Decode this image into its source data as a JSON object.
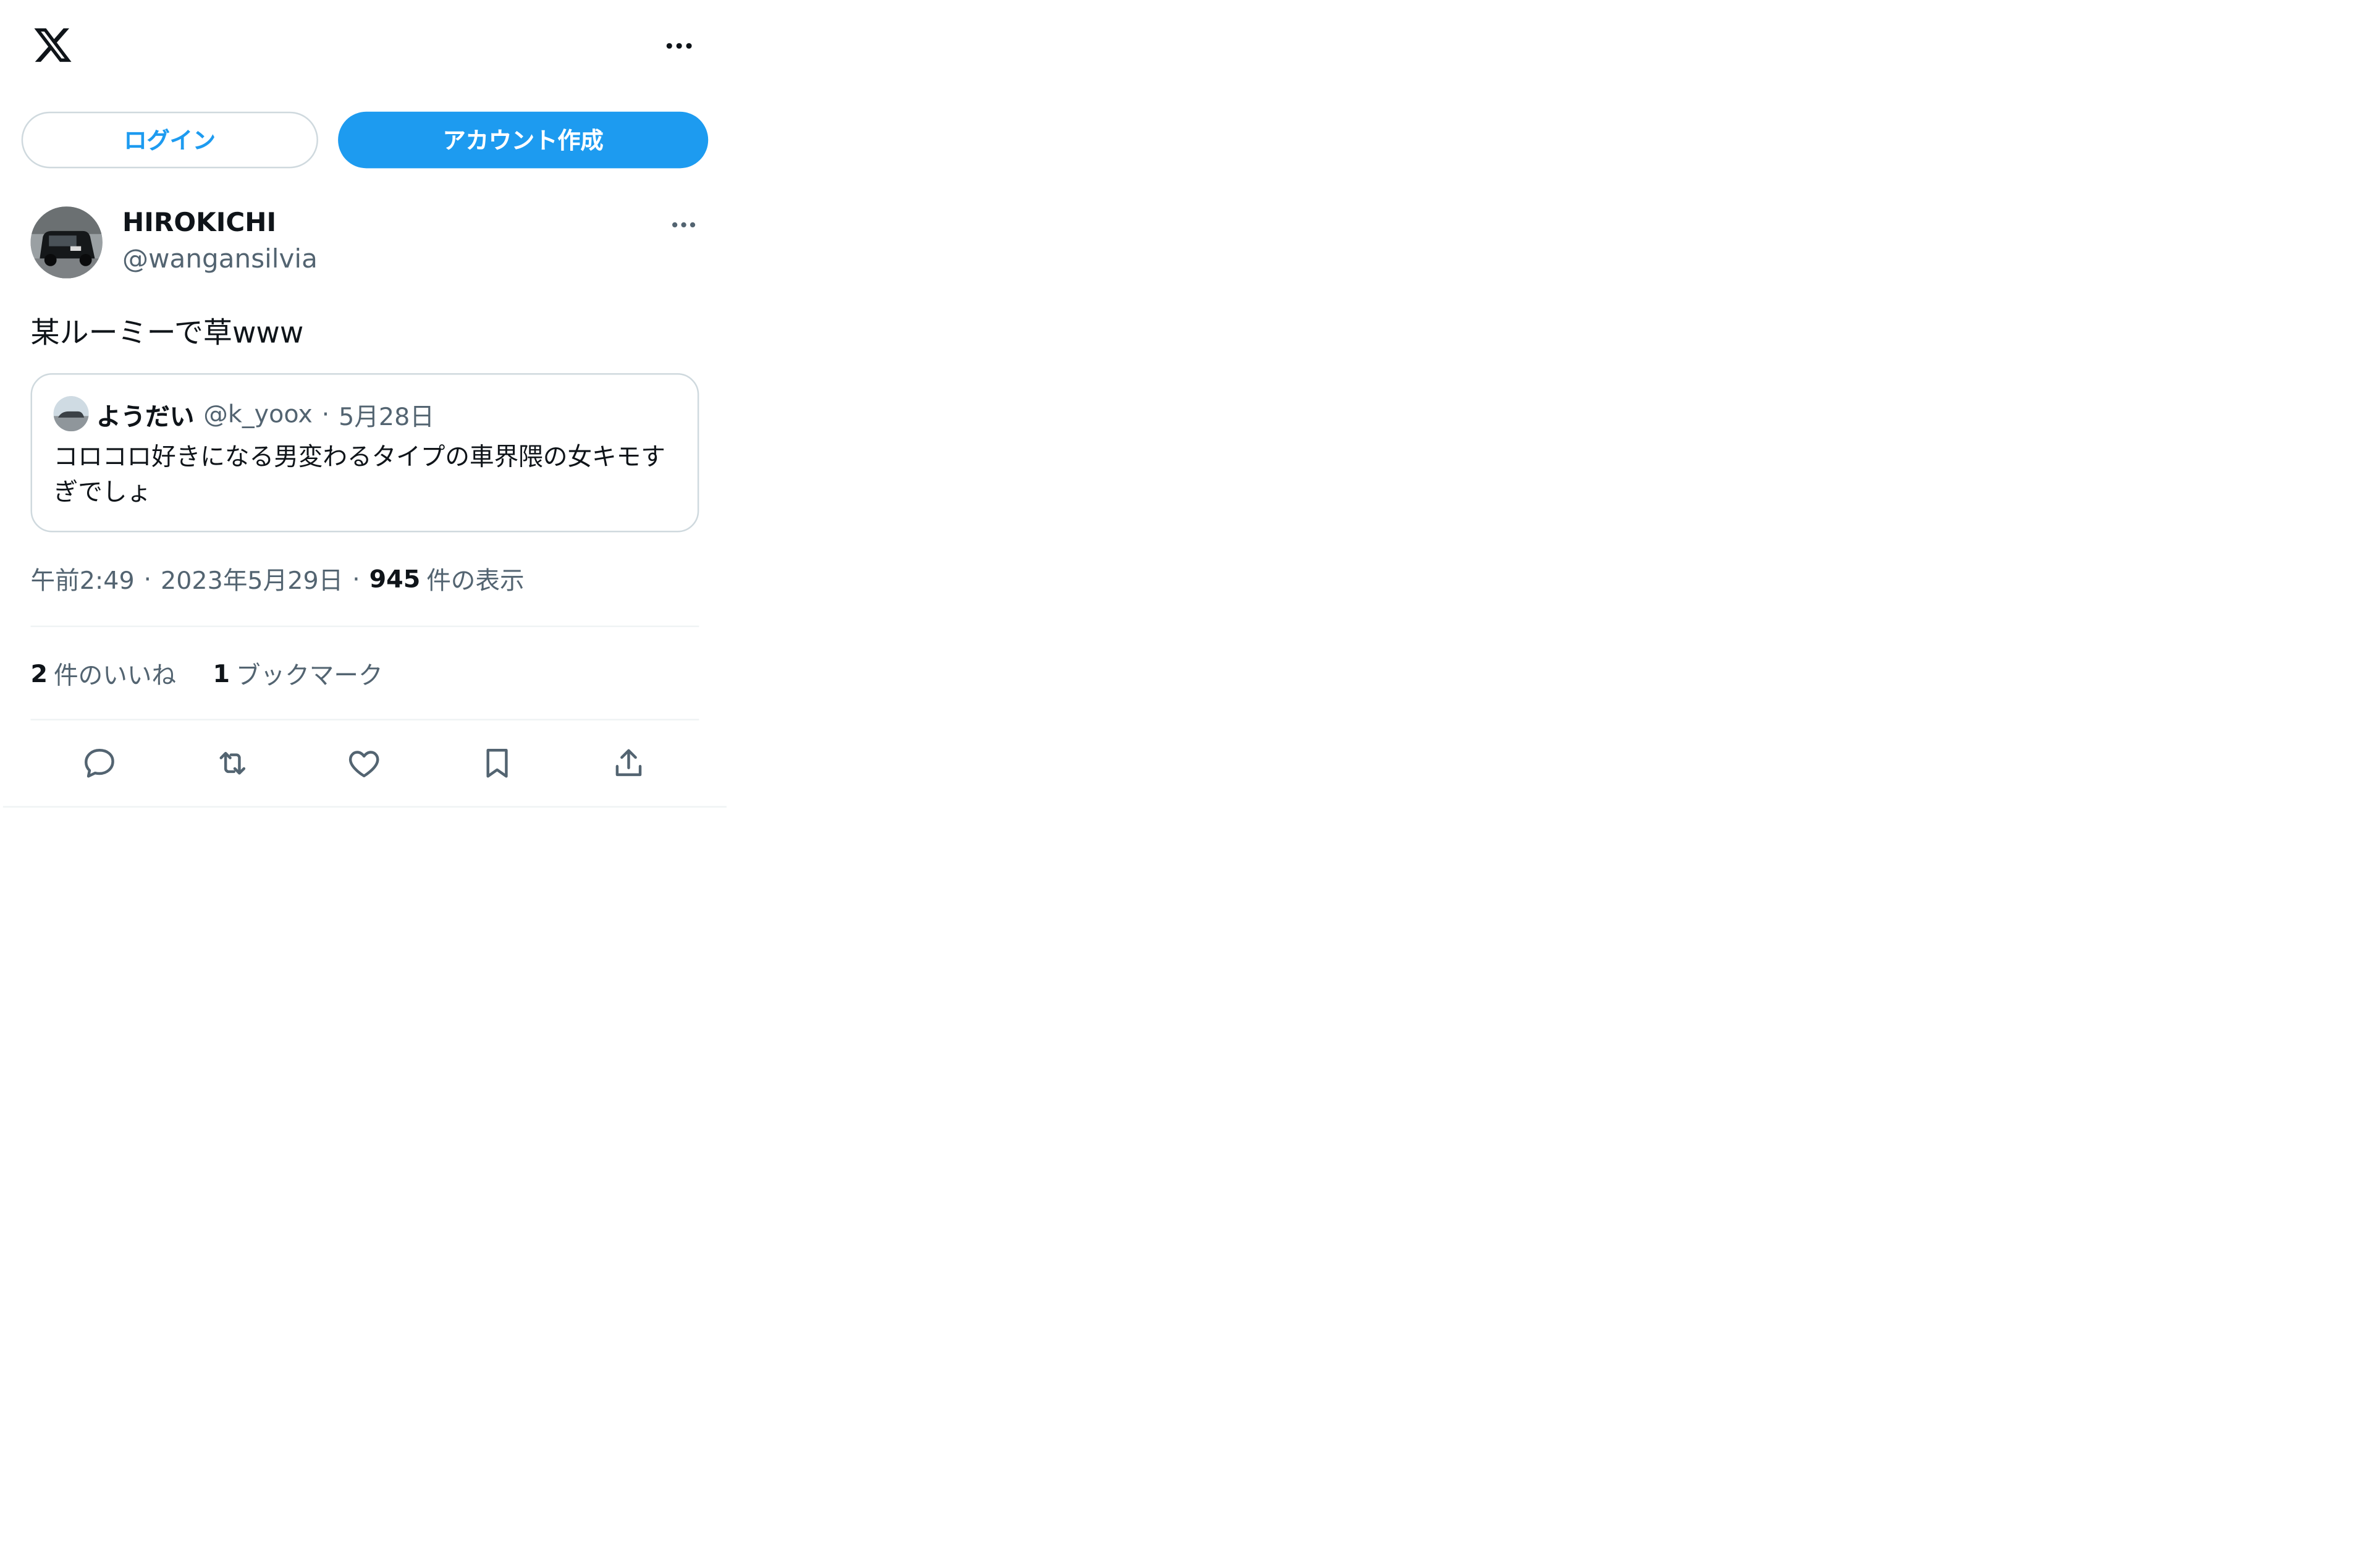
{
  "header": {
    "logo_icon": "x-logo-icon",
    "more_icon": "more-horizontal-icon"
  },
  "auth": {
    "login_label": "ログイン",
    "signup_label": "アカウント作成"
  },
  "tweet": {
    "author_name": "HIROKICHI",
    "author_handle": "@wangansilvia",
    "text": "某ルーミーで草www",
    "quote": {
      "author_name": "ようだい",
      "author_handle": "@k_yoox",
      "separator": "·",
      "date": "5月28日",
      "text": "コロコロ好きになる男変わるタイプの車界隈の女キモすぎでしょ"
    },
    "meta": {
      "time": "午前2:49",
      "separator1": "·",
      "date": "2023年5月29日",
      "separator2": "·",
      "views_count": "945",
      "views_label": "件の表示"
    },
    "stats": {
      "likes_count": "2",
      "likes_label": "件のいいね",
      "bookmarks_count": "1",
      "bookmarks_label": "ブックマーク"
    },
    "actions": [
      "reply-icon",
      "retweet-icon",
      "like-icon",
      "bookmark-icon",
      "share-icon"
    ]
  },
  "colors": {
    "accent": "#1d9bf0",
    "text_primary": "#0f1419",
    "text_secondary": "#536471",
    "border": "#cfd9de",
    "divider": "#eff3f4"
  }
}
